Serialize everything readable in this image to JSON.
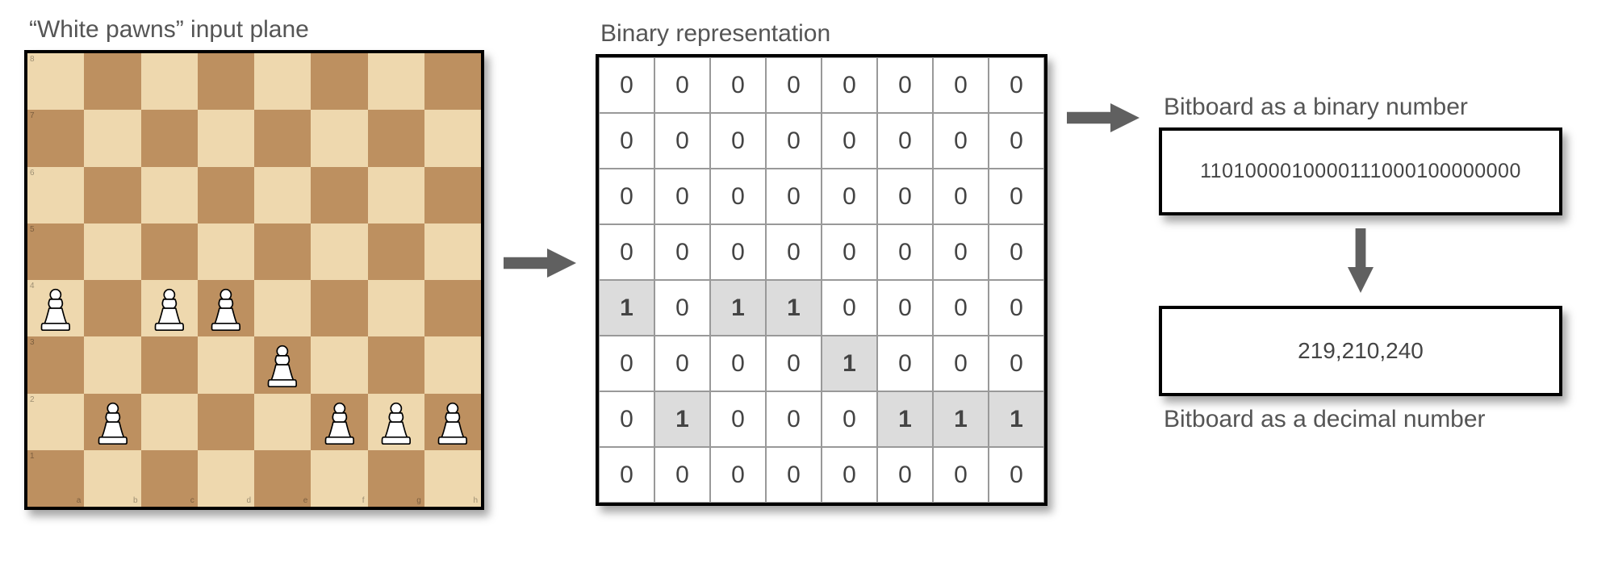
{
  "titles": {
    "chess": "“White pawns” input plane",
    "grid": "Binary representation",
    "binary": "Bitboard as a binary number",
    "decimal": "Bitboard as a decimal number"
  },
  "board": {
    "light_color": "#eed8ae",
    "dark_color": "#bd9060",
    "files": [
      "a",
      "b",
      "c",
      "d",
      "e",
      "f",
      "g",
      "h"
    ],
    "ranks": [
      "8",
      "7",
      "6",
      "5",
      "4",
      "3",
      "2",
      "1"
    ],
    "pawns": [
      {
        "r": 4,
        "c": 0
      },
      {
        "r": 4,
        "c": 2
      },
      {
        "r": 4,
        "c": 3
      },
      {
        "r": 5,
        "c": 4
      },
      {
        "r": 6,
        "c": 1
      },
      {
        "r": 6,
        "c": 5
      },
      {
        "r": 6,
        "c": 6
      },
      {
        "r": 6,
        "c": 7
      }
    ]
  },
  "chart_data": {
    "type": "heatmap",
    "title": "Binary representation",
    "grid": [
      [
        0,
        0,
        0,
        0,
        0,
        0,
        0,
        0
      ],
      [
        0,
        0,
        0,
        0,
        0,
        0,
        0,
        0
      ],
      [
        0,
        0,
        0,
        0,
        0,
        0,
        0,
        0
      ],
      [
        0,
        0,
        0,
        0,
        0,
        0,
        0,
        0
      ],
      [
        1,
        0,
        1,
        1,
        0,
        0,
        0,
        0
      ],
      [
        0,
        0,
        0,
        0,
        1,
        0,
        0,
        0
      ],
      [
        0,
        1,
        0,
        0,
        0,
        1,
        1,
        1
      ],
      [
        0,
        0,
        0,
        0,
        0,
        0,
        0,
        0
      ]
    ]
  },
  "values": {
    "binary": "1101000010000111000100000000",
    "decimal": "219,210,240"
  }
}
